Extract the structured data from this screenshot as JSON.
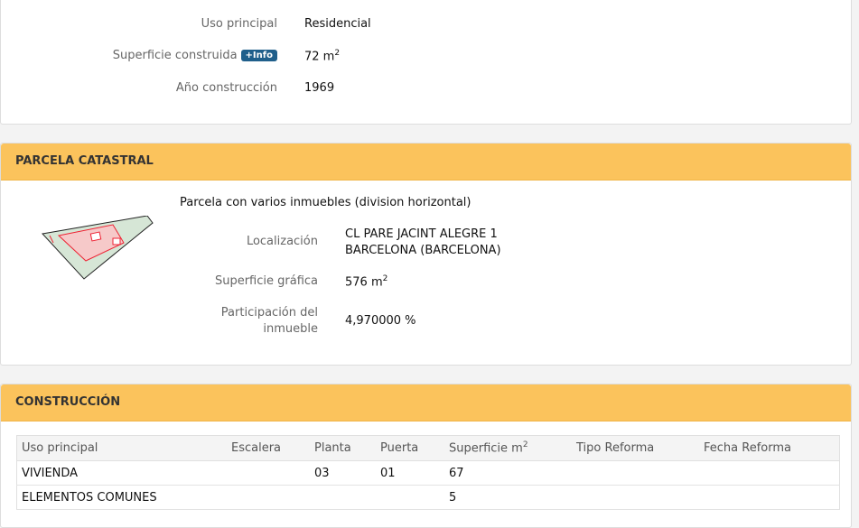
{
  "inmueble": {
    "uso_label": "Uso principal",
    "uso_value": "Residencial",
    "superficie_label": "Superficie construida",
    "info_badge": "+Info",
    "superficie_value": "72 m",
    "superficie_sup": "2",
    "anio_label": "Año construcción",
    "anio_value": "1969"
  },
  "parcela": {
    "heading": "PARCELA CATASTRAL",
    "descripcion": "Parcela con varios inmuebles (division horizontal)",
    "localizacion_label": "Localización",
    "localizacion_line1": "CL PARE JACINT ALEGRE 1",
    "localizacion_line2": "BARCELONA (BARCELONA)",
    "superficie_label": "Superficie gráfica",
    "superficie_value": "576 m",
    "superficie_sup": "2",
    "participacion_label_1": "Participación del",
    "participacion_label_2": "inmueble",
    "participacion_value": "4,970000 %"
  },
  "construccion": {
    "heading": "CONSTRUCCIÓN",
    "columns": [
      "Uso principal",
      "Escalera",
      "Planta",
      "Puerta",
      "Superficie m",
      "Tipo Reforma",
      "Fecha Reforma"
    ],
    "superficie_sup": "2",
    "rows": [
      [
        "VIVIENDA",
        "",
        "03",
        "01",
        "67",
        "",
        ""
      ],
      [
        "ELEMENTOS COMUNES",
        "",
        "",
        "",
        "5",
        "",
        ""
      ]
    ]
  },
  "colors": {
    "heading_bg": "#fbc35c",
    "badge_bg": "#1f5f8b"
  }
}
